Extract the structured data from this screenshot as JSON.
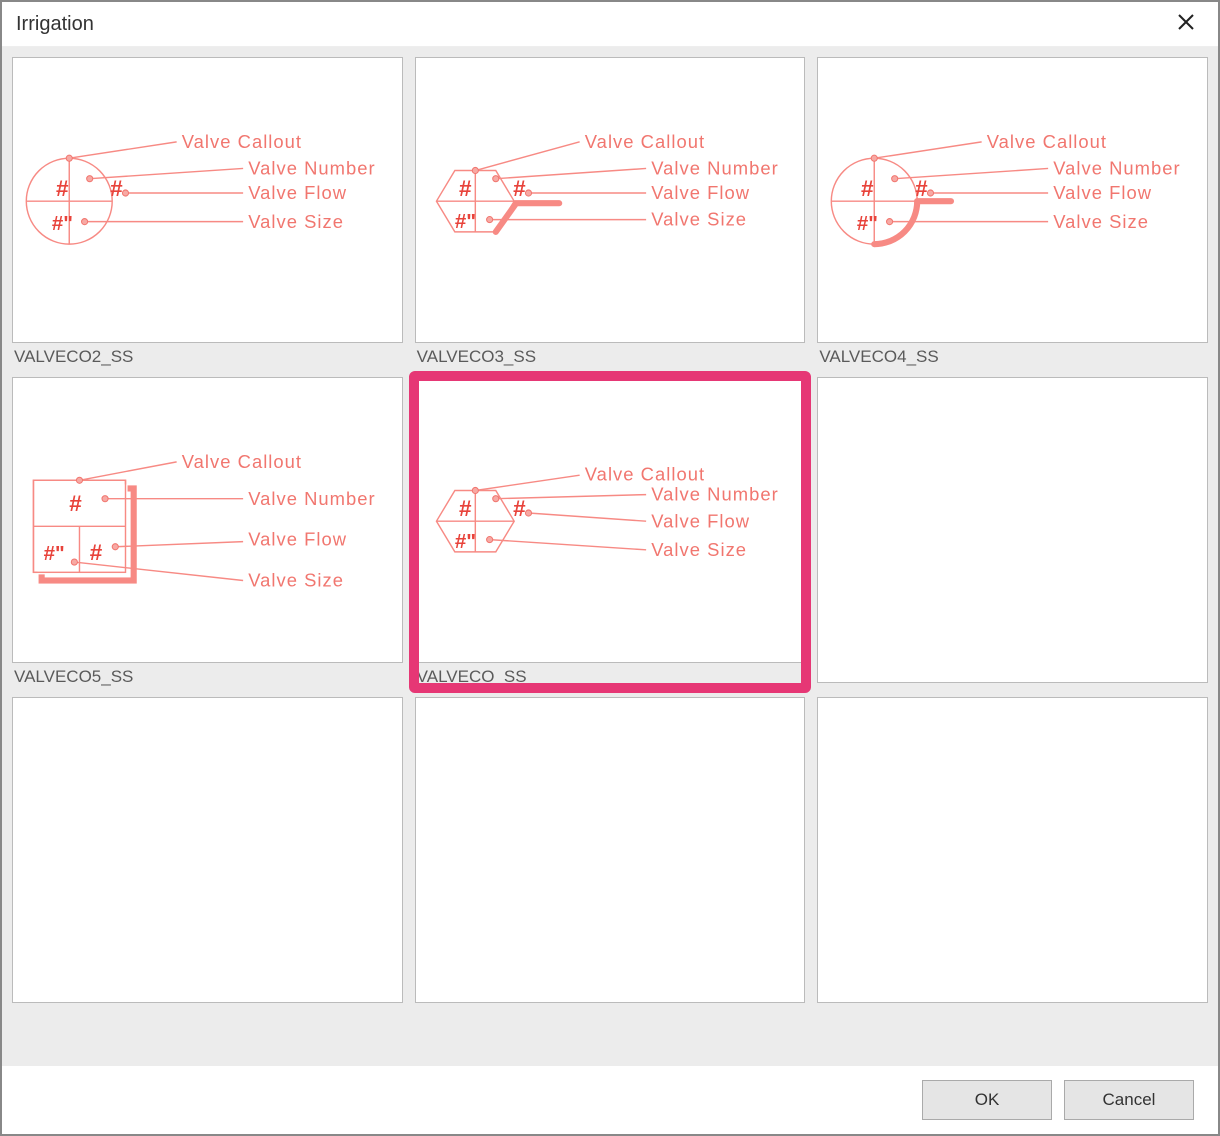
{
  "dialog": {
    "title": "Irrigation",
    "ok_label": "OK",
    "cancel_label": "Cancel"
  },
  "labels": {
    "valve_callout": "Valve  Callout",
    "valve_number": "Valve  Number",
    "valve_flow": "Valve  Flow",
    "valve_size": "Valve  Size",
    "hash": "#",
    "hash_quote": "#\""
  },
  "items": [
    {
      "name": "VALVECO2_SS",
      "shape": "circle",
      "highlighted": false
    },
    {
      "name": "VALVECO3_SS",
      "shape": "hexagon-heavy",
      "highlighted": false
    },
    {
      "name": "VALVECO4_SS",
      "shape": "circle-heavy",
      "highlighted": false
    },
    {
      "name": "VALVECO5_SS",
      "shape": "square",
      "highlighted": false
    },
    {
      "name": "VALVECO_SS",
      "shape": "hexagon",
      "highlighted": true
    },
    {
      "name": "",
      "shape": "",
      "highlighted": false
    },
    {
      "name": "",
      "shape": "",
      "highlighted": false
    },
    {
      "name": "",
      "shape": "",
      "highlighted": false
    },
    {
      "name": "",
      "shape": "",
      "highlighted": false
    }
  ]
}
